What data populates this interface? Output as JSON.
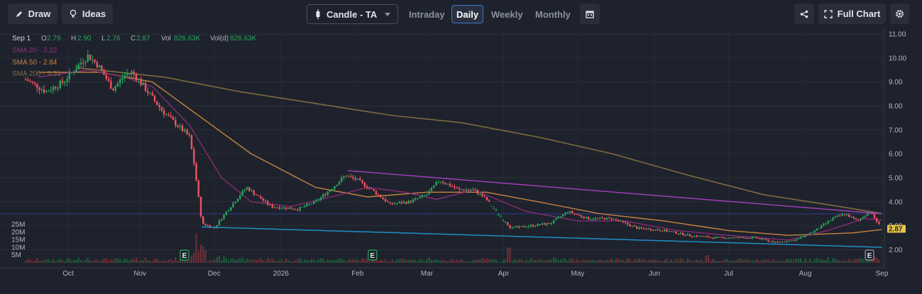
{
  "toolbar": {
    "draw_label": "Draw",
    "ideas_label": "Ideas",
    "chart_type_label": "Candle - TA",
    "timeframes": [
      "Intraday",
      "Daily",
      "Weekly",
      "Monthly"
    ],
    "active_timeframe": "Daily",
    "full_chart_label": "Full Chart"
  },
  "legend": {
    "date": "Sep 1",
    "o_label": "O",
    "o_value": "2.79",
    "h_label": "H",
    "h_value": "2.90",
    "l_label": "L",
    "l_value": "2.76",
    "c_label": "C",
    "c_value": "2.87",
    "vol_label": "Vol",
    "vol_value": "826.63K",
    "vold_label": "Vol(d)",
    "vold_value": "826.63K",
    "sma20": "SMA 20 - 3.22",
    "sma50": "SMA 50 - 2.84",
    "sma200": "SMA 200 - 3.51"
  },
  "last_price_tag": "2.87",
  "colors": {
    "background": "#1e222d",
    "up": "#26a65b",
    "down": "#ef5360",
    "sma20": "#8e2d7a",
    "sma50": "#c7833c",
    "sma200": "#7f6b3e",
    "trendline_upper": "#9c3fb5",
    "trendline_lower": "#1e8fc8",
    "horizontal_line": "#2d3a8c",
    "price_tag": "#e8c547"
  },
  "chart_data": {
    "type": "candlestick",
    "title": "",
    "x_ticks": [
      "Oct",
      "Nov",
      "Dec",
      "2026",
      "Feb",
      "Mar",
      "Apr",
      "May",
      "Jun",
      "Jul",
      "Aug",
      "Sep"
    ],
    "y_ticks": [
      "11.00",
      "10.00",
      "9.00",
      "8.00",
      "7.00",
      "6.00",
      "5.00",
      "4.00",
      "3.00",
      "2.00"
    ],
    "ylim": [
      1.6,
      11.0
    ],
    "volume_ticks": [
      "25M",
      "20M",
      "15M",
      "10M",
      "5M"
    ],
    "volume_ylim": [
      0,
      28
    ],
    "earnings_markers": [
      {
        "date": "2025-11-23",
        "label": "E"
      },
      {
        "date": "2026-02-07",
        "label": "E"
      },
      {
        "date": "2026-08-27",
        "label": "E"
      }
    ],
    "price_path": [
      [
        "2025-09-20",
        9.1
      ],
      [
        "2025-09-28",
        8.6
      ],
      [
        "2025-10-05",
        9.0
      ],
      [
        "2025-10-12",
        9.8
      ],
      [
        "2025-10-15",
        10.1
      ],
      [
        "2025-10-19",
        9.7
      ],
      [
        "2025-10-25",
        8.7
      ],
      [
        "2025-10-30",
        9.3
      ],
      [
        "2025-11-02",
        9.4
      ],
      [
        "2025-11-08",
        8.6
      ],
      [
        "2025-11-14",
        7.8
      ],
      [
        "2025-11-19",
        7.3
      ],
      [
        "2025-11-25",
        6.7
      ],
      [
        "2025-11-27",
        5.5
      ],
      [
        "2025-11-30",
        3.1
      ],
      [
        "2025-12-05",
        2.9
      ],
      [
        "2025-12-10",
        3.6
      ],
      [
        "2025-12-18",
        4.6
      ],
      [
        "2025-12-28",
        3.8
      ],
      [
        "2026-01-08",
        3.7
      ],
      [
        "2026-01-15",
        4.0
      ],
      [
        "2026-01-22",
        4.6
      ],
      [
        "2026-01-27",
        5.1
      ],
      [
        "2026-02-01",
        4.9
      ],
      [
        "2026-02-08",
        4.4
      ],
      [
        "2026-02-14",
        3.9
      ],
      [
        "2026-02-22",
        4.0
      ],
      [
        "2026-03-01",
        4.3
      ],
      [
        "2026-03-06",
        4.9
      ],
      [
        "2026-03-14",
        4.5
      ],
      [
        "2026-03-20",
        4.5
      ],
      [
        "2026-03-25",
        4.1
      ],
      [
        "2026-04-04",
        2.9
      ],
      [
        "2026-04-12",
        3.0
      ],
      [
        "2026-04-20",
        3.1
      ],
      [
        "2026-04-27",
        3.6
      ],
      [
        "2026-05-05",
        3.3
      ],
      [
        "2026-05-15",
        3.3
      ],
      [
        "2026-05-25",
        2.9
      ],
      [
        "2026-06-05",
        2.8
      ],
      [
        "2026-06-15",
        2.6
      ],
      [
        "2026-06-25",
        2.5
      ],
      [
        "2026-07-05",
        2.5
      ],
      [
        "2026-07-12",
        2.5
      ],
      [
        "2026-07-20",
        2.3
      ],
      [
        "2026-07-28",
        2.4
      ],
      [
        "2026-08-05",
        2.8
      ],
      [
        "2026-08-12",
        3.3
      ],
      [
        "2026-08-17",
        3.5
      ],
      [
        "2026-08-22",
        3.2
      ],
      [
        "2026-08-27",
        3.6
      ],
      [
        "2026-09-01",
        2.87
      ]
    ],
    "sma20": [
      [
        "2025-09-25",
        9.2
      ],
      [
        "2025-10-15",
        9.5
      ],
      [
        "2025-10-30",
        9.2
      ],
      [
        "2025-11-10",
        8.8
      ],
      [
        "2025-11-25",
        7.2
      ],
      [
        "2025-12-08",
        5.0
      ],
      [
        "2025-12-20",
        4.0
      ],
      [
        "2026-01-05",
        3.8
      ],
      [
        "2026-01-25",
        4.3
      ],
      [
        "2026-02-05",
        4.6
      ],
      [
        "2026-02-20",
        4.4
      ],
      [
        "2026-03-05",
        4.1
      ],
      [
        "2026-03-20",
        4.5
      ],
      [
        "2026-04-10",
        3.6
      ],
      [
        "2026-05-01",
        3.2
      ],
      [
        "2026-05-20",
        3.2
      ],
      [
        "2026-06-10",
        2.8
      ],
      [
        "2026-07-01",
        2.6
      ],
      [
        "2026-07-25",
        2.4
      ],
      [
        "2026-08-10",
        2.8
      ],
      [
        "2026-08-25",
        3.3
      ],
      [
        "2026-09-01",
        3.22
      ]
    ],
    "sma50": [
      [
        "2025-09-25",
        9.4
      ],
      [
        "2025-10-20",
        9.4
      ],
      [
        "2025-11-10",
        9.0
      ],
      [
        "2025-11-30",
        7.5
      ],
      [
        "2025-12-20",
        6.0
      ],
      [
        "2026-01-15",
        4.6
      ],
      [
        "2026-02-05",
        4.2
      ],
      [
        "2026-03-01",
        4.4
      ],
      [
        "2026-03-25",
        4.4
      ],
      [
        "2026-04-15",
        4.0
      ],
      [
        "2026-05-10",
        3.5
      ],
      [
        "2026-06-05",
        3.2
      ],
      [
        "2026-07-01",
        2.8
      ],
      [
        "2026-07-25",
        2.6
      ],
      [
        "2026-08-20",
        2.7
      ],
      [
        "2026-09-01",
        2.84
      ]
    ],
    "sma200": [
      [
        "2025-10-10",
        9.6
      ],
      [
        "2025-11-15",
        9.2
      ],
      [
        "2025-12-15",
        8.6
      ],
      [
        "2026-01-15",
        8.1
      ],
      [
        "2026-02-15",
        7.6
      ],
      [
        "2026-03-15",
        7.3
      ],
      [
        "2026-04-15",
        6.7
      ],
      [
        "2026-05-15",
        6.0
      ],
      [
        "2026-06-15",
        5.1
      ],
      [
        "2026-07-15",
        4.3
      ],
      [
        "2026-08-15",
        3.8
      ],
      [
        "2026-09-01",
        3.51
      ]
    ],
    "trendline_upper": [
      [
        "2026-01-28",
        5.3
      ],
      [
        "2026-09-01",
        3.5
      ]
    ],
    "trendline_lower": [
      [
        "2025-11-30",
        2.95
      ],
      [
        "2026-09-01",
        2.1
      ]
    ],
    "horizontal_line": 3.5
  }
}
